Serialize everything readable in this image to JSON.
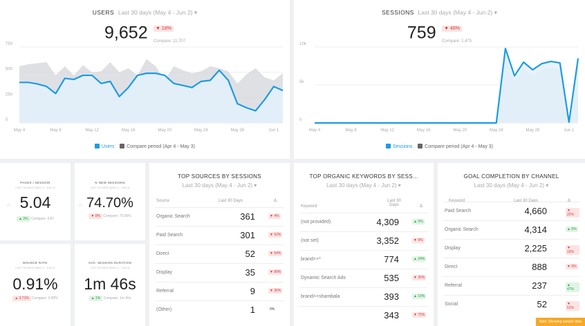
{
  "users": {
    "title": "USERS",
    "period": "Last 30 days (May 4 - Jun 2)",
    "value": "9,652",
    "change": "▼ 18%",
    "compare": "Compare: 11,707",
    "y_ticks": [
      "750",
      "500",
      "250",
      "0"
    ],
    "x_ticks": [
      "May 4",
      "May 8",
      "May 12",
      "May 16",
      "May 20",
      "May 24",
      "May 28",
      "Jun 1"
    ],
    "legend_current": "Users",
    "legend_compare": "Compare period (Apr 4 - May 3)"
  },
  "sessions": {
    "title": "SESSIONS",
    "period": "Last 30 days (May 4 - Jun 2)",
    "value": "759",
    "change": "▼ 48%",
    "compare": "Compare: 1,475",
    "y_ticks": [
      "10k",
      "5k",
      "0"
    ],
    "x_ticks": [
      "May 4",
      "May 8",
      "May 12",
      "May 16",
      "May 20",
      "May 24",
      "May 28",
      "Jun 1"
    ],
    "legend_current": "Sessions",
    "legend_compare": "Compare period (Apr 4 - May 3)"
  },
  "kpis": [
    {
      "title": "PAGES / SESSION",
      "sub": "LAST 30 DAYS (MAY 4 - JUN 2)",
      "value": "5.04",
      "change": "▲ 3%",
      "direction": "up",
      "compare": "Compare: 4.87"
    },
    {
      "title": "% NEW SESSIONS",
      "sub": "LAST 30 DAYS (MAY 4 - JUN 2)",
      "value": "74.70%",
      "change": "▼ 0%",
      "direction": "down",
      "compare": "Compare: 75.06%"
    },
    {
      "title": "BOUNCE RATE",
      "sub": "LAST 30 DAYS (MAY 4 - JUN 2)",
      "value": "0.91%",
      "change": "▲ 3.71%",
      "direction": "down",
      "compare": "Compare: 3.90%"
    },
    {
      "title": "AVG. SESSION DURATION",
      "sub": "LAST 30 DAYS (MAY 4 - JUN 2)",
      "value": "1m 46s",
      "change": "▲ 1%",
      "direction": "up",
      "compare": "Compare: 1m 45s"
    }
  ],
  "top_sources": {
    "title": "TOP SOURCES BY SESSIONS",
    "period": "Last 30 days (May 4 - Jun 2)",
    "col1": "Source",
    "col2": "Last 30 Days",
    "col3": "Δ",
    "rows": [
      {
        "name": "Organic Search",
        "value": "361",
        "change": "▼ 4%",
        "dir": "down"
      },
      {
        "name": "Paid Search",
        "value": "301",
        "change": "▼ 52%",
        "dir": "down"
      },
      {
        "name": "Direct",
        "value": "52",
        "change": "▼ 54%",
        "dir": "down"
      },
      {
        "name": "Display",
        "value": "35",
        "change": "▼ 89%",
        "dir": "down"
      },
      {
        "name": "Referral",
        "value": "9",
        "change": "▼ 36%",
        "dir": "down"
      },
      {
        "name": "(Other)",
        "value": "1",
        "change": "0%",
        "dir": "none"
      }
    ]
  },
  "top_keywords": {
    "title": "TOP ORGANIC KEYWORDS BY SESS...",
    "period": "Last 30 days (May 4 - Jun 2)",
    "col1": "Keyword",
    "col2": "Last 30 Days",
    "col3": "Δ",
    "rows": [
      {
        "name": "(not provided)",
        "value": "4,309",
        "change": "▲ 5%",
        "dir": "up"
      },
      {
        "name": "(not set)",
        "value": "3,352",
        "change": "▼ 9%",
        "dir": "down"
      },
      {
        "name": "brand=+*",
        "value": "774",
        "change": "▲ 34%",
        "dir": "up"
      },
      {
        "name": "Dynamic Search Ads",
        "value": "535",
        "change": "▼ 35%",
        "dir": "down"
      },
      {
        "name": "brand=+shambala",
        "value": "393",
        "change": "▲ 19%",
        "dir": "up"
      },
      {
        "name": "",
        "value": "343",
        "change": "▼ 75%",
        "dir": "down"
      }
    ]
  },
  "goal_completion": {
    "title": "GOAL COMPLETION BY CHANNEL",
    "period": "Last 30 days (May 4 - Jun 2)",
    "col1": "Keyword",
    "col2": "Last 30 Days",
    "col3": "Δ",
    "rows": [
      {
        "name": "Paid Search",
        "value": "4,660",
        "change": "▼ 22%",
        "dir": "down"
      },
      {
        "name": "Organic Search",
        "value": "4,314",
        "change": "▲ 5%",
        "dir": "up"
      },
      {
        "name": "Display",
        "value": "2,225",
        "change": "▼ 15%",
        "dir": "down"
      },
      {
        "name": "Direct",
        "value": "888",
        "change": "▼ 9%",
        "dir": "down"
      },
      {
        "name": "Referral",
        "value": "237",
        "change": "▲ 47%",
        "dir": "up"
      },
      {
        "name": "Social",
        "value": "52",
        "change": "▼ 51%",
        "dir": "down"
      }
    ]
  },
  "note": "Note: Showing sample data",
  "colors": {
    "primary": "#1a9be6",
    "compare": "#d4d6da",
    "red": "#d23c3c",
    "green": "#2a9d48"
  },
  "chart_data": [
    {
      "type": "area",
      "title": "USERS",
      "x": [
        "May 4",
        "May 5",
        "May 6",
        "May 7",
        "May 8",
        "May 9",
        "May 10",
        "May 11",
        "May 12",
        "May 13",
        "May 14",
        "May 15",
        "May 16",
        "May 17",
        "May 18",
        "May 19",
        "May 20",
        "May 21",
        "May 22",
        "May 23",
        "May 24",
        "May 25",
        "May 26",
        "May 27",
        "May 28",
        "May 29",
        "May 30",
        "May 31",
        "Jun 1",
        "Jun 2"
      ],
      "series": [
        {
          "name": "Users",
          "values": [
            400,
            400,
            385,
            360,
            290,
            440,
            430,
            470,
            470,
            390,
            410,
            260,
            350,
            470,
            490,
            490,
            470,
            390,
            370,
            350,
            410,
            420,
            520,
            420,
            190,
            150,
            120,
            230,
            360,
            320
          ]
        },
        {
          "name": "Compare period (Apr 4 - May 3)",
          "values": [
            560,
            580,
            590,
            600,
            470,
            560,
            470,
            570,
            500,
            510,
            600,
            500,
            540,
            470,
            630,
            560,
            420,
            560,
            520,
            490,
            510,
            560,
            540,
            510,
            390,
            480,
            540,
            450,
            420,
            490
          ]
        }
      ],
      "ylim": [
        0,
        750
      ]
    },
    {
      "type": "area",
      "title": "SESSIONS",
      "x": [
        "May 4",
        "May 5",
        "May 6",
        "May 7",
        "May 8",
        "May 9",
        "May 10",
        "May 11",
        "May 12",
        "May 13",
        "May 14",
        "May 15",
        "May 16",
        "May 17",
        "May 18",
        "May 19",
        "May 20",
        "May 21",
        "May 22",
        "May 23",
        "May 24",
        "May 25",
        "May 26",
        "May 27",
        "May 28",
        "May 29",
        "May 30",
        "May 31",
        "Jun 1",
        "Jun 2"
      ],
      "series": [
        {
          "name": "Sessions",
          "values": [
            0,
            0,
            0,
            0,
            0,
            0,
            0,
            0,
            0,
            0,
            0,
            0,
            0,
            0,
            0,
            0,
            0,
            0,
            0,
            0,
            0,
            9800,
            6200,
            8000,
            7000,
            7800,
            8100,
            7900,
            100,
            8500
          ]
        },
        {
          "name": "Compare period (Apr 4 - May 3)",
          "values": [
            0,
            0,
            0,
            0,
            0,
            0,
            0,
            0,
            0,
            0,
            0,
            0,
            0,
            0,
            0,
            0,
            0,
            0,
            0,
            0,
            0,
            8800,
            5600,
            7200,
            6300,
            7000,
            7300,
            7100,
            100,
            7700
          ]
        }
      ],
      "ylim": [
        0,
        10000
      ]
    }
  ]
}
